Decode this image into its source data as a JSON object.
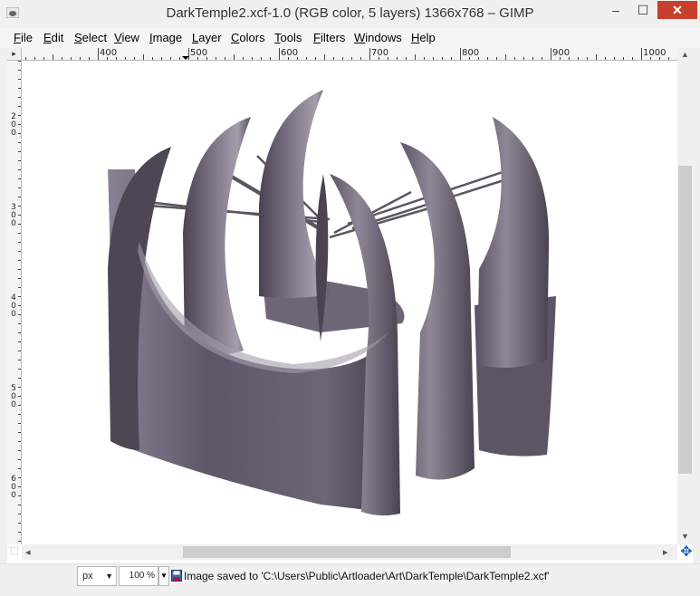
{
  "window": {
    "title": "DarkTemple2.xcf-1.0 (RGB color, 5 layers) 1366x768 – GIMP",
    "controls": {
      "minimize": "–",
      "maximize": "☐",
      "close": "✕"
    }
  },
  "menu": {
    "items": [
      "File",
      "Edit",
      "Select",
      "View",
      "Image",
      "Layer",
      "Colors",
      "Tools",
      "Filters",
      "Windows",
      "Help"
    ]
  },
  "rulers": {
    "corner_glyph": "▸",
    "horizontal": [
      "400",
      "500",
      "600",
      "700",
      "800",
      "900",
      "1000"
    ],
    "vertical": [
      "200",
      "300",
      "400",
      "500",
      "600"
    ]
  },
  "scrollbars": {
    "up": "▲",
    "down": "▼",
    "left": "◂",
    "right": "▸"
  },
  "navigate_glyph": "✥",
  "quick_mask_glyph": "⬚",
  "status": {
    "units": "px",
    "units_arrow": "▼",
    "zoom": "100 %",
    "zoom_arrow": "▼",
    "message": "Image saved to 'C:\\Users\\Public\\Artloader\\Art\\DarkTemple\\DarkTemple2.xcf'"
  },
  "colors": {
    "temple_dark": "#4a4351",
    "temple_mid": "#6e6677",
    "temple_light": "#a49dab",
    "cable": "#5a5560",
    "close_button": "#c7402c"
  }
}
